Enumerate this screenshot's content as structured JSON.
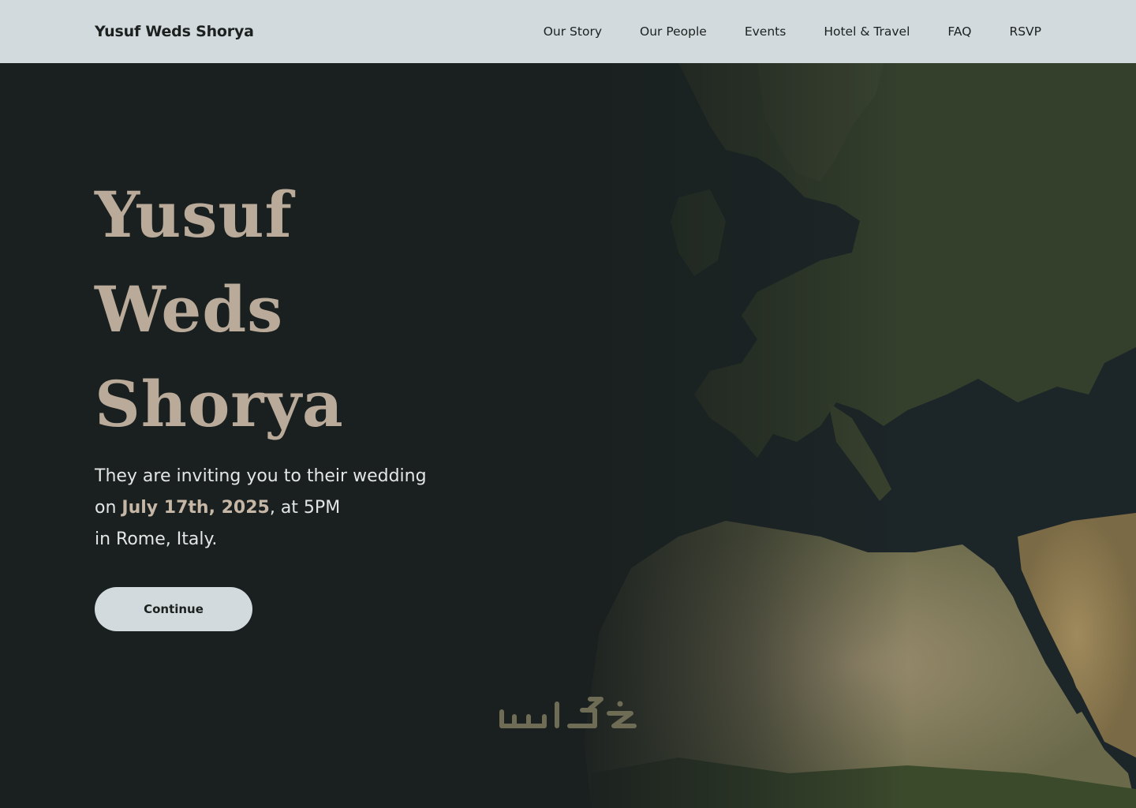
{
  "header": {
    "brand": "Yusuf Weds Shorya",
    "nav": [
      {
        "label": "Our Story"
      },
      {
        "label": "Our People"
      },
      {
        "label": "Events"
      },
      {
        "label": "Hotel & Travel"
      },
      {
        "label": "FAQ"
      },
      {
        "label": "RSVP"
      }
    ]
  },
  "hero": {
    "title_lines": [
      "Yusuf",
      "Weds",
      "Shorya"
    ],
    "invite": {
      "line1": "They are inviting you to their wedding",
      "line2_prefix": "on ",
      "date": "July 17th, 2025",
      "line2_suffix": ", at 5PM",
      "line3": "in Rome, Italy."
    },
    "cta_label": "Continue",
    "background_icon": "world-map-europe-africa"
  },
  "watermark": {
    "icon": "khamsat-logo"
  },
  "colors": {
    "header_bg": "#d2dadd",
    "page_bg": "#1a201f",
    "title": "#b9aa9a",
    "date_accent": "#c5b6a6",
    "button_bg": "#d2dadd"
  }
}
